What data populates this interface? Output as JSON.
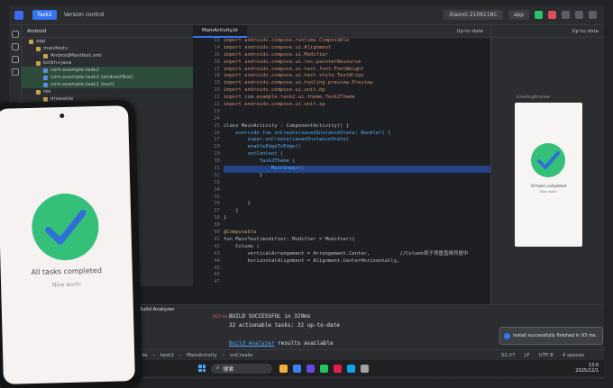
{
  "ide": {
    "project_name": "Task2",
    "version_control": "Version control",
    "device": "Xiaomi 2106118C",
    "app_config": "app",
    "status": "Up-to-date",
    "preview_status": "Up-to-date",
    "view_mode": "Android",
    "editor_tab": "MainActivity.kt",
    "preview_label": "GreetingPreview",
    "tree": [
      {
        "label": "app",
        "type": "folder"
      },
      {
        "label": "manifests",
        "type": "folder"
      },
      {
        "label": "AndroidManifest.xml",
        "type": "file"
      },
      {
        "label": "kotlin+java",
        "type": "folder"
      },
      {
        "label": "com.example.task2",
        "type": "package"
      },
      {
        "label": "com.example.task2 (androidTest)",
        "type": "package"
      },
      {
        "label": "com.example.task2 (test)",
        "type": "package"
      },
      {
        "label": "res",
        "type": "folder"
      },
      {
        "label": "drawable",
        "type": "folder"
      }
    ],
    "line_numbers": [
      "13",
      "14",
      "15",
      "16",
      "17",
      "18",
      "19",
      "20",
      "21",
      "22",
      "23",
      "24",
      "25",
      "26",
      "27",
      "28",
      "29",
      "30",
      "31",
      "32",
      "33",
      "34",
      "35",
      "36",
      "37",
      "38",
      "39",
      "40",
      "41",
      "42",
      "43",
      "44",
      "45",
      "46",
      "47"
    ],
    "code_lines": [
      "import androidx.compose.runtime.Composable",
      "import androidx.compose.ui.Alignment",
      "import androidx.compose.ui.Modifier",
      "import androidx.compose.ui.res.painterResource",
      "import androidx.compose.ui.text.font.FontWeight",
      "import androidx.compose.ui.text.style.TextAlign",
      "import androidx.compose.ui.tooling.preview.Preview",
      "import androidx.compose.ui.unit.dp",
      "import com.example.task2.ui.theme.Task2Theme",
      "import androidx.compose.ui.unit.sp",
      "",
      "",
      "class MainActivity : ComponentActivity() {",
      "    override fun onCreate(savedInstanceState: Bundle?) {",
      "        super.onCreate(savedInstanceState)",
      "        enableEdgeToEdge()",
      "        setContent {",
      "            Task2Theme {",
      "                MainImage()",
      "            }",
      "",
      "",
      "",
      "        }",
      "    }",
      "}",
      "",
      "@Composable",
      "fun MainText(modifier: Modifier = Modifier){",
      "    Column (",
      "        verticalArrangement = Arrangement.Center,          //Column将子项垂直排列居中",
      "        horizontalAlignment = Alignment.CenterHorizontally,",
      "",
      "",
      ""
    ],
    "selected_line": 18,
    "bottom_panel": {
      "tab": "Build Analyzer",
      "error_count": "407 ms",
      "lines": [
        "BUILD SUCCESSFUL in 329ms",
        "32 actionable tasks: 32 up-to-date",
        "",
        "Build Analyzer results available"
      ],
      "link_text": "Build Analyzer",
      "link_tail": " results available"
    },
    "toast": "Install successfully finished in 93 ms.",
    "breadcrumbs": [
      "example",
      "task2",
      "MainActivity",
      "onCreate"
    ],
    "status_right": [
      "32:27",
      "LF",
      "UTF-8",
      "4 spaces"
    ]
  },
  "taskbar": {
    "search_placeholder": "搜索",
    "time": "13:0",
    "date": "2025/12/1"
  },
  "phone": {
    "title": "All tasks completed",
    "subtitle": "Nice work!"
  },
  "preview_phone": {
    "title": "All tasks completed",
    "subtitle": "Nice work!"
  },
  "colors": {
    "check_green": "#35c07a",
    "check_blue": "#2f6fd6",
    "selection": "#214283",
    "accent": "#3574f0"
  }
}
